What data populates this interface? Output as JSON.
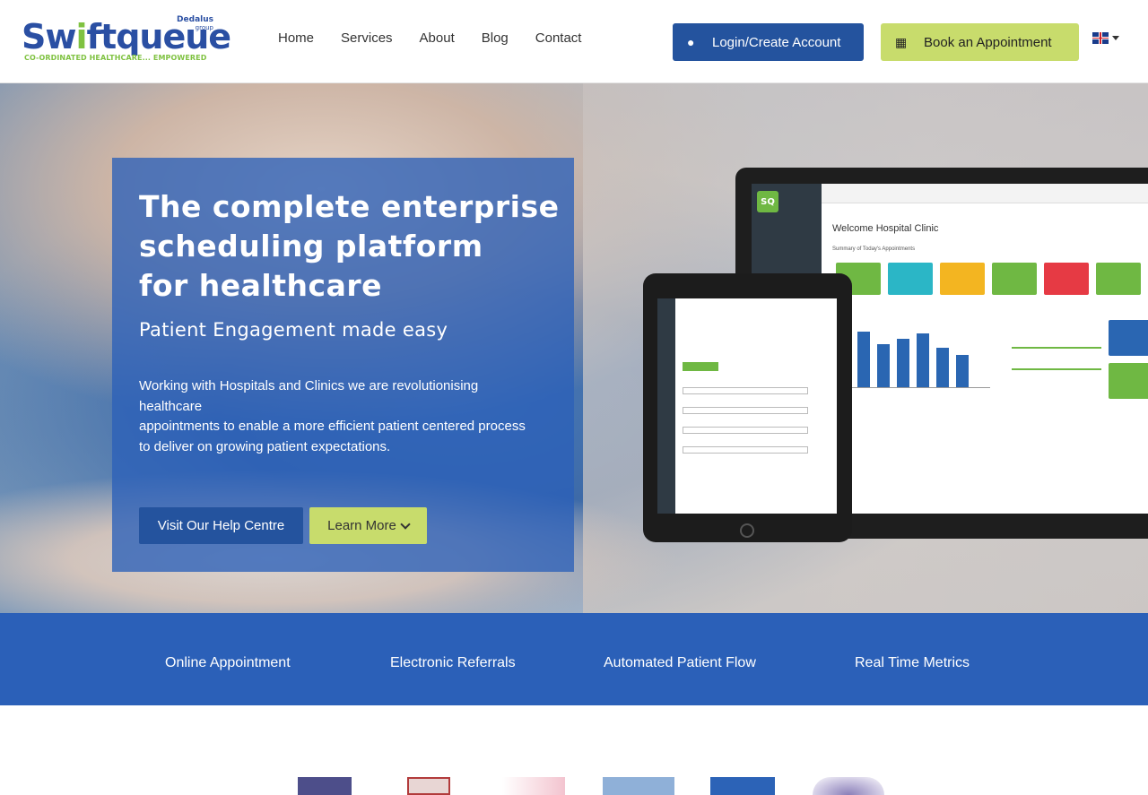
{
  "header": {
    "logo": {
      "brand_pre": "Sw",
      "brand_i": "i",
      "brand_post": "ftqueue",
      "tagline": "CO-ORDINATED HEALTHCARE... EMPOWERED",
      "dedalus": "Dedalus",
      "dedalus_group": "group"
    },
    "nav": [
      {
        "label": "Home"
      },
      {
        "label": "Services"
      },
      {
        "label": "About"
      },
      {
        "label": "Blog"
      },
      {
        "label": "Contact"
      }
    ],
    "login_label": "Login/Create Account",
    "book_label": "Book an Appointment",
    "language_flag": "uk-flag-icon"
  },
  "hero": {
    "title_lines": [
      "The complete enterprise",
      "scheduling platform",
      "for healthcare"
    ],
    "subtitle": "Patient Engagement made easy",
    "description_lines": [
      "Working with Hospitals and Clinics we are revolutionising healthcare",
      "appointments to enable a more efficient patient centered process",
      "to deliver on growing patient expectations."
    ],
    "help_button": "Visit Our Help Centre",
    "learn_button": "Learn More"
  },
  "features": [
    {
      "label": "Online Appointment"
    },
    {
      "label": "Electronic Referrals"
    },
    {
      "label": "Automated Patient Flow"
    },
    {
      "label": "Real Time Metrics"
    }
  ],
  "colors": {
    "primary_blue": "#24539e",
    "accent_green": "#c8dc6c",
    "panel_blue": "#2b60b8",
    "logo_blue": "#2a4fa3",
    "logo_green": "#7fc241"
  }
}
